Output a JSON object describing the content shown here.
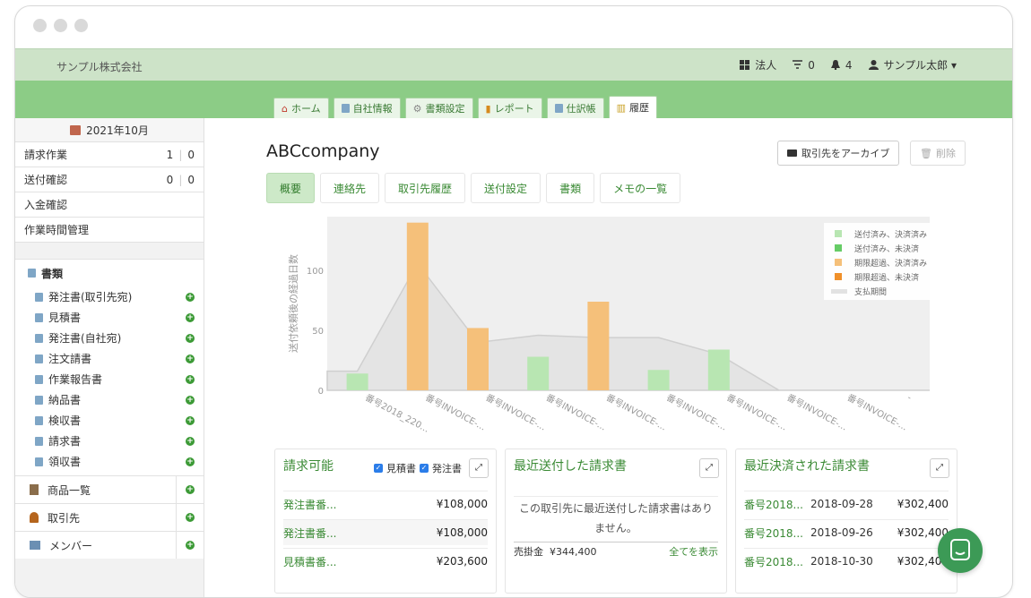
{
  "header": {
    "company": "サンプル株式会社",
    "nav": [
      {
        "icon": "grid-icon",
        "label": "法人"
      },
      {
        "icon": "filter-icon",
        "label": "0"
      },
      {
        "icon": "bell-icon",
        "label": "4"
      },
      {
        "icon": "user-icon",
        "label": "サンプル太郎 ▾"
      }
    ]
  },
  "tabs": [
    {
      "icon": "home-icon",
      "label": "ホーム"
    },
    {
      "icon": "building-icon",
      "label": "自社情報"
    },
    {
      "icon": "gear-icon",
      "label": "書類設定"
    },
    {
      "icon": "chart-icon",
      "label": "レポート"
    },
    {
      "icon": "book-icon",
      "label": "仕訳帳"
    },
    {
      "icon": "history-icon",
      "label": "履歴"
    }
  ],
  "sidebar": {
    "month": "2021年10月",
    "tasks": [
      {
        "label": "請求作業",
        "a": "1",
        "b": "0"
      },
      {
        "label": "送付確認",
        "a": "0",
        "b": "0"
      },
      {
        "label": "入金確認"
      },
      {
        "label": "作業時間管理"
      }
    ],
    "documents_title": "書類",
    "documents": [
      "発注書(取引先宛)",
      "見積書",
      "発注書(自社宛)",
      "注文請書",
      "作業報告書",
      "納品書",
      "検収書",
      "請求書",
      "領収書"
    ],
    "more": [
      {
        "icon": "products-icon",
        "label": "商品一覧"
      },
      {
        "icon": "person-icon",
        "label": "取引先"
      },
      {
        "icon": "members-icon",
        "label": "メンバー"
      }
    ]
  },
  "main": {
    "title": "ABCcompany",
    "archive_label": "取引先をアーカイブ",
    "delete_label": "削除",
    "subtabs": [
      "概要",
      "連絡先",
      "取引先履歴",
      "送付設定",
      "書類",
      "メモの一覧"
    ]
  },
  "chart_data": {
    "type": "bar",
    "ylabel": "送付依頼後の経過日数",
    "ylim": [
      0,
      145
    ],
    "yticks": [
      0,
      50,
      100
    ],
    "categories": [
      "番号2018_220...",
      "番号INVOICE-...",
      "番号INVOICE-...",
      "番号INVOICE-...",
      "番号INVOICE-...",
      "番号INVOICE-...",
      "番号INVOICE-...",
      "番号INVOICE-...",
      "番号INVOICE-...",
      "-"
    ],
    "series": [
      {
        "name": "送付済み、決済済み",
        "color": "#b8e6b2",
        "values": [
          14,
          0,
          0,
          28,
          0,
          17,
          34,
          0,
          0,
          0
        ]
      },
      {
        "name": "送付済み、未決済",
        "color": "#66cc66",
        "values": [
          0,
          0,
          0,
          0,
          0,
          0,
          0,
          0,
          0,
          0
        ]
      },
      {
        "name": "期限超過、決済済み",
        "color": "#f5c07a",
        "values": [
          0,
          140,
          52,
          0,
          74,
          0,
          0,
          0,
          0,
          0
        ]
      },
      {
        "name": "期限超過、未決済",
        "color": "#f0902a",
        "values": [
          0,
          0,
          0,
          0,
          0,
          0,
          0,
          0,
          0,
          0
        ]
      }
    ],
    "line": {
      "name": "支払期間",
      "values": [
        16,
        106,
        40,
        46,
        44,
        44,
        30,
        0,
        0,
        0
      ]
    },
    "legend": "top-right"
  },
  "panels": {
    "billable": {
      "title": "請求可能",
      "check1": "見積書",
      "check2": "発注書",
      "rows": [
        {
          "label": "発注書番...",
          "amount": "¥108,000"
        },
        {
          "label": "発注書番...",
          "amount": "¥108,000"
        },
        {
          "label": "見積書番...",
          "amount": "¥203,600"
        }
      ]
    },
    "recent_sent": {
      "title": "最近送付した請求書",
      "empty": "この取引先に最近送付した請求書はありません。",
      "ar_label": "売掛金",
      "ar_amount": "¥344,400",
      "show_all": "全てを表示"
    },
    "recent_settled": {
      "title": "最近決済された請求書",
      "rows": [
        {
          "label": "番号2018...",
          "date": "2018-09-28",
          "amount": "¥302,400"
        },
        {
          "label": "番号2018...",
          "date": "2018-09-26",
          "amount": "¥302,400"
        },
        {
          "label": "番号2018...",
          "date": "2018-10-30",
          "amount": "¥302,400"
        }
      ]
    }
  }
}
